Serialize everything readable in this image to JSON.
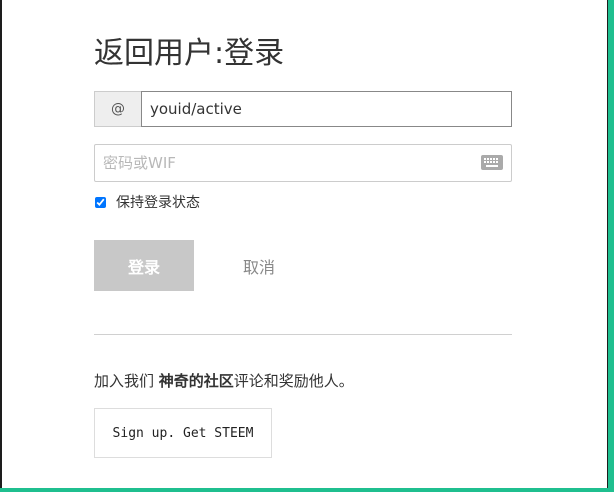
{
  "colors": {
    "accent": "#1fbf8f",
    "disabled_button": "#c8c8c8"
  },
  "login": {
    "title": "返回用户:登录",
    "username_prefix": "@",
    "username_value": "youid/active",
    "password_placeholder": "密码或WIF",
    "password_icon": "keyboard-icon",
    "remember_label": "保持登录状态",
    "remember_checked": true,
    "login_label": "登录",
    "cancel_label": "取消"
  },
  "join": {
    "text_before": "加入我们 ",
    "text_emphasis": "神奇的社区",
    "text_after": "评论和奖励他人。",
    "signup_label": "Sign up. Get STEEM"
  }
}
